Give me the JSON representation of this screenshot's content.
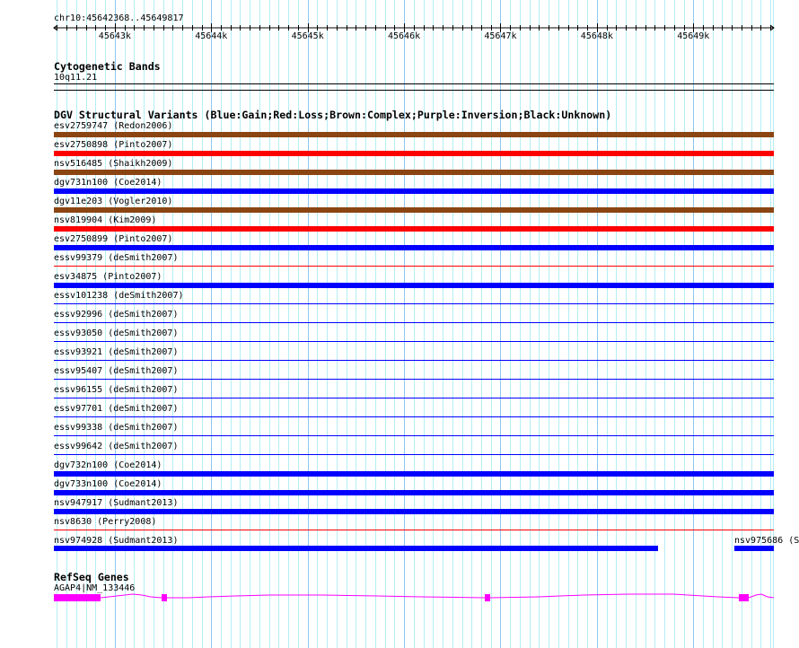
{
  "ruler": {
    "title": "chr10:45642368..45649817",
    "start": 45642368,
    "end": 45649817,
    "tick_labels": [
      {
        "label": "45643k",
        "pos": 45643000
      },
      {
        "label": "45644k",
        "pos": 45644000
      },
      {
        "label": "45645k",
        "pos": 45645000
      },
      {
        "label": "45646k",
        "pos": 45646000
      },
      {
        "label": "45647k",
        "pos": 45647000
      },
      {
        "label": "45648k",
        "pos": 45648000
      },
      {
        "label": "45649k",
        "pos": 45649000
      }
    ]
  },
  "cytoband": {
    "title": "Cytogenetic Bands",
    "band": "10q11.21"
  },
  "dgv": {
    "title": "DGV Structural Variants (Blue:Gain;Red:Loss;Brown:Complex;Purple:Inversion;Black:Unknown)",
    "colors": {
      "gain": "#0000ff",
      "loss": "#ff0000",
      "complex": "#8b4513"
    },
    "rows": [
      {
        "label": "esv2759747 (Redon2006)",
        "type": "complex",
        "style": "thick"
      },
      {
        "label": "esv2750898 (Pinto2007)",
        "type": "loss",
        "style": "thick"
      },
      {
        "label": "nsv516485 (Shaikh2009)",
        "type": "complex",
        "style": "thick"
      },
      {
        "label": "dgv731n100 (Coe2014)",
        "type": "gain",
        "style": "thick"
      },
      {
        "label": "dgv11e203 (Vogler2010)",
        "type": "complex",
        "style": "thick"
      },
      {
        "label": "nsv819904 (Kim2009)",
        "type": "loss",
        "style": "thick"
      },
      {
        "label": "esv2750899 (Pinto2007)",
        "type": "gain",
        "style": "thick"
      },
      {
        "label": "essv99379 (deSmith2007)",
        "type": "loss",
        "style": "thin"
      },
      {
        "label": "esv34875 (Pinto2007)",
        "type": "gain",
        "style": "thick"
      },
      {
        "label": "essv101238 (deSmith2007)",
        "type": "gain",
        "style": "thin"
      },
      {
        "label": "essv92996 (deSmith2007)",
        "type": "gain",
        "style": "thin"
      },
      {
        "label": "essv93050 (deSmith2007)",
        "type": "gain",
        "style": "thin"
      },
      {
        "label": "essv93921 (deSmith2007)",
        "type": "gain",
        "style": "thin"
      },
      {
        "label": "essv95407 (deSmith2007)",
        "type": "gain",
        "style": "thin"
      },
      {
        "label": "essv96155 (deSmith2007)",
        "type": "gain",
        "style": "thin"
      },
      {
        "label": "essv97701 (deSmith2007)",
        "type": "gain",
        "style": "thin"
      },
      {
        "label": "essv99338 (deSmith2007)",
        "type": "gain",
        "style": "thin"
      },
      {
        "label": "essv99642 (deSmith2007)",
        "type": "gain",
        "style": "thin"
      },
      {
        "label": "dgv732n100 (Coe2014)",
        "type": "gain",
        "style": "thick"
      },
      {
        "label": "dgv733n100 (Coe2014)",
        "type": "gain",
        "style": "thick"
      },
      {
        "label": "nsv947917 (Sudmant2013)",
        "type": "gain",
        "style": "thick"
      },
      {
        "label": "nsv8630 (Perry2008)",
        "type": "loss",
        "style": "thin"
      }
    ],
    "last_row": [
      {
        "label": "nsv974928 (Sudmant2013)",
        "type": "gain"
      },
      {
        "label": "nsv975686 (S",
        "type": "gain"
      }
    ]
  },
  "refseq": {
    "title": "RefSeq Genes",
    "gene_label": "AGAP4|NM_133446",
    "color": "#ff00ff"
  }
}
